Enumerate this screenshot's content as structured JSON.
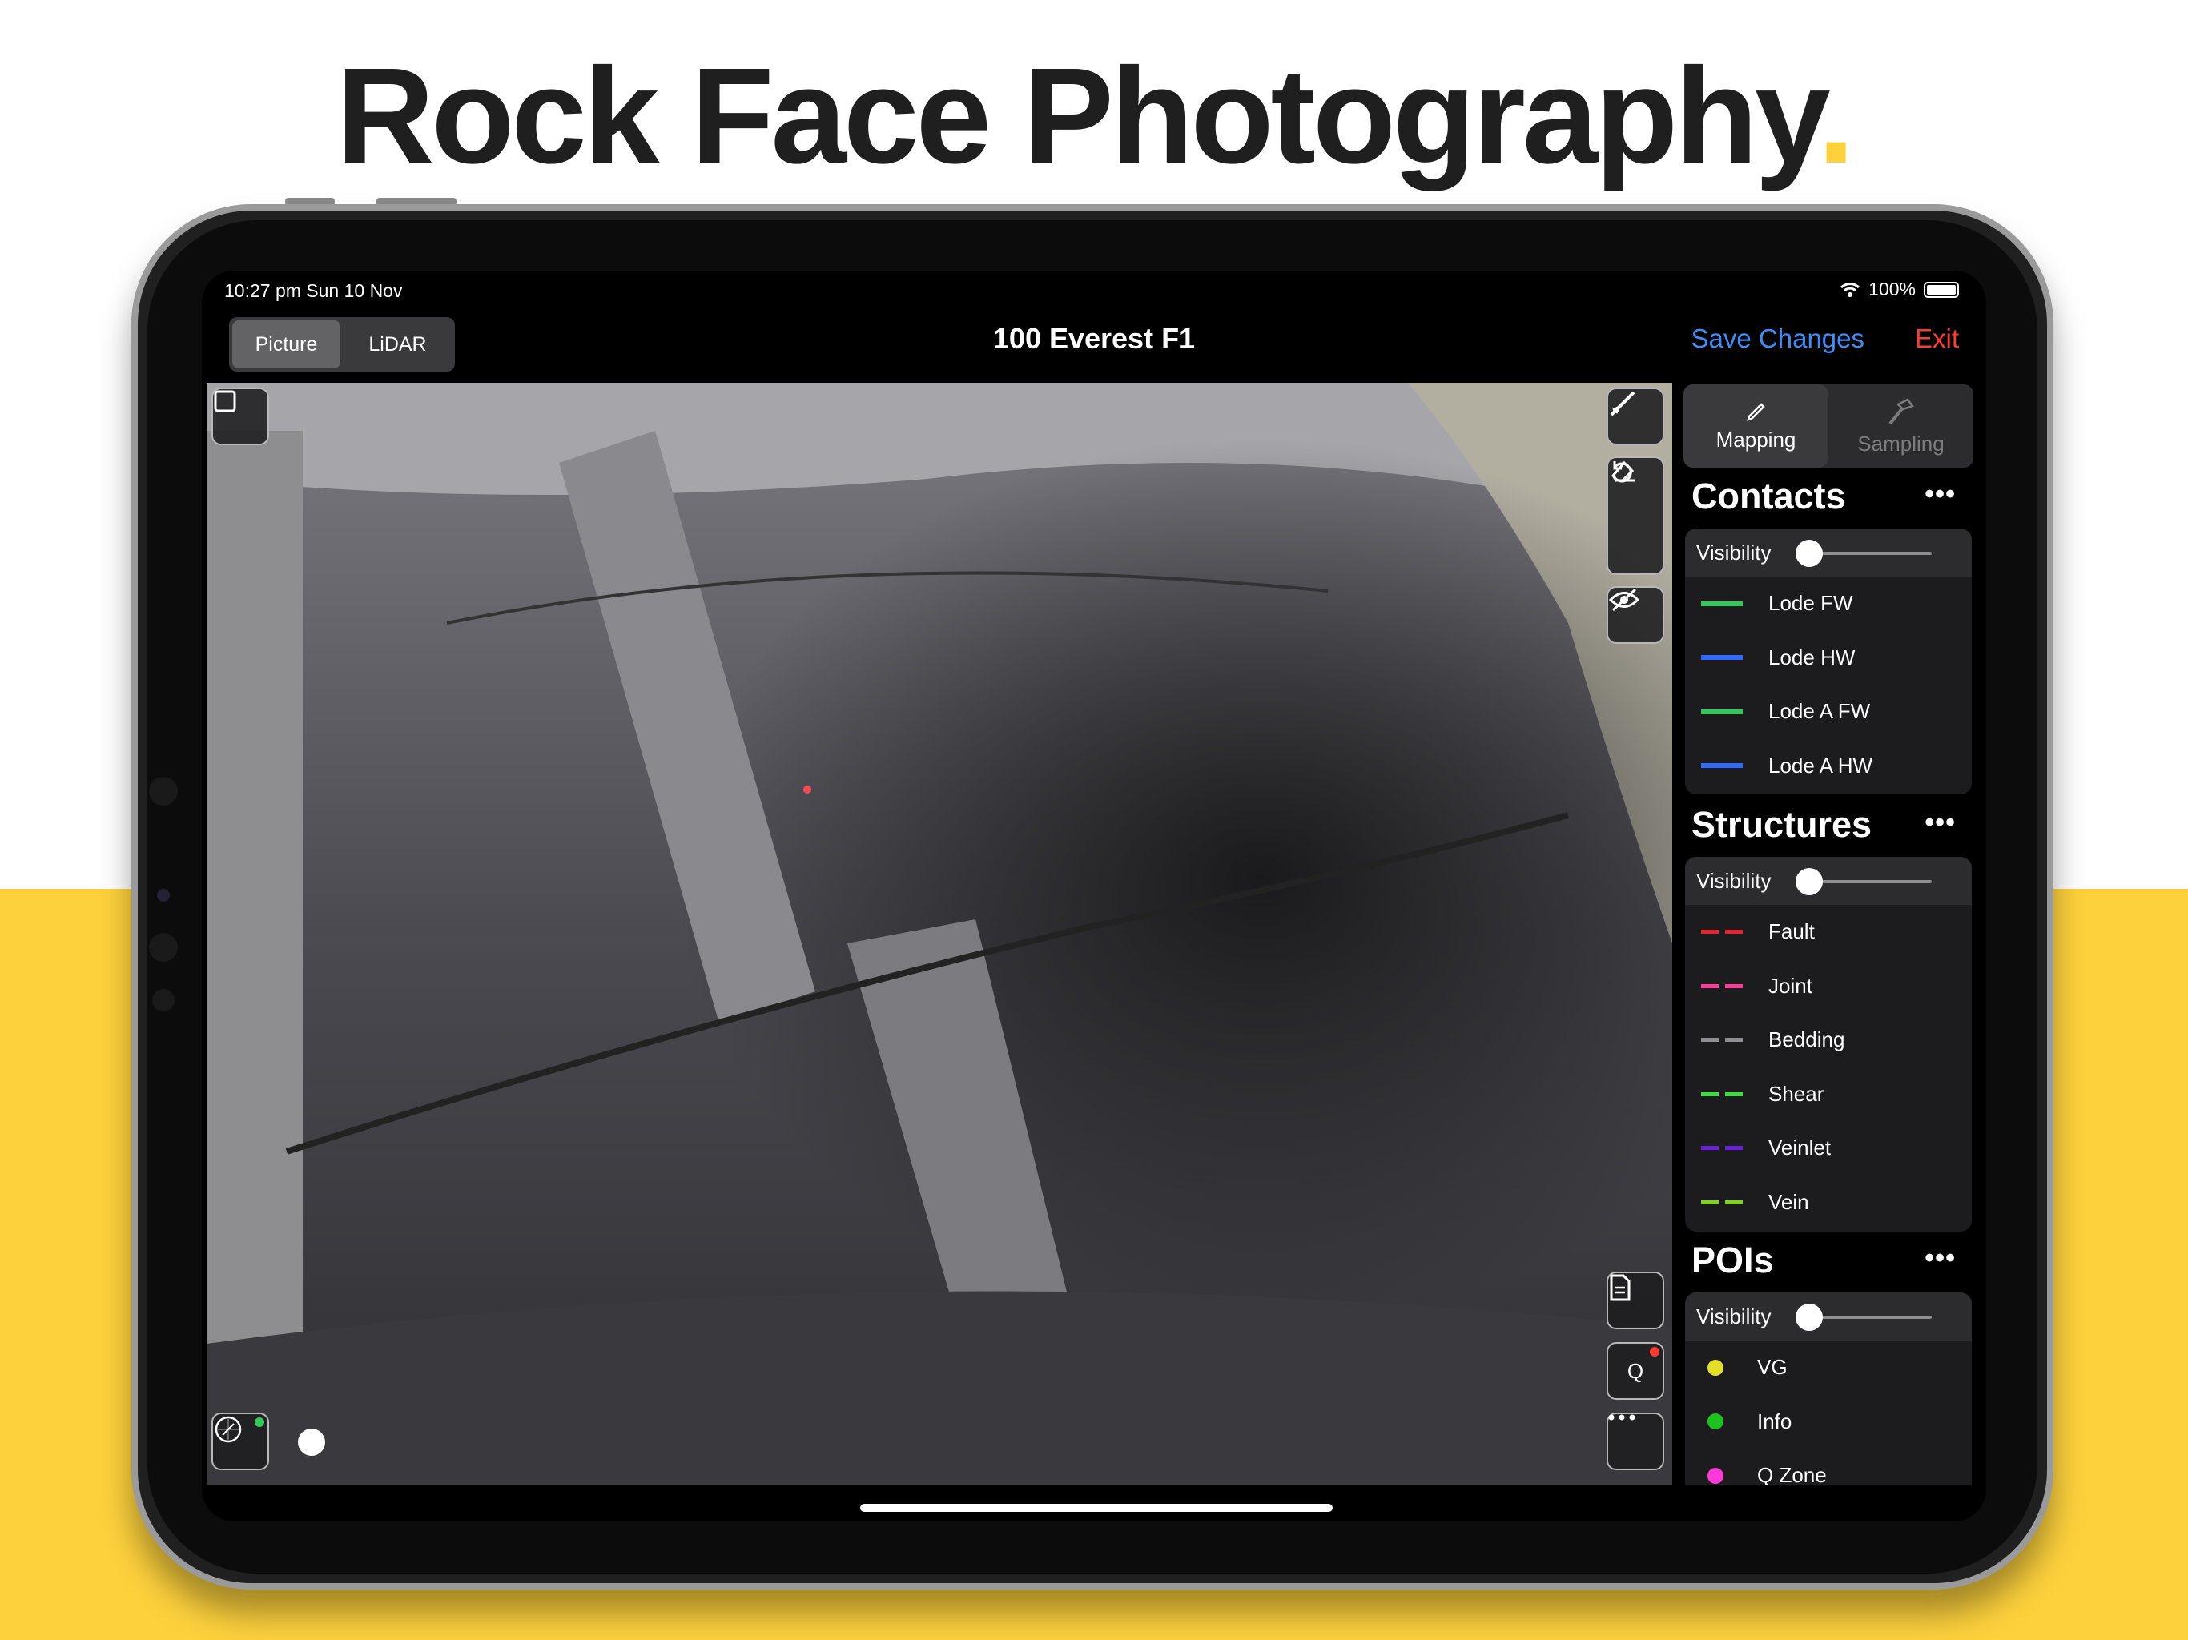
{
  "marketing": {
    "headline": "Rock Face Photography",
    "headline_dot": ".",
    "accent_color": "#fdd13c"
  },
  "status": {
    "time": "10:27 pm   Sun 10 Nov",
    "battery": "100%",
    "wifi_icon": "wifi-icon",
    "battery_level": 1.0
  },
  "header": {
    "segments": [
      {
        "label": "Picture",
        "active": true
      },
      {
        "label": "LiDAR",
        "active": false
      }
    ],
    "title": "100 Everest F1",
    "save_label": "Save Changes",
    "exit_label": "Exit"
  },
  "tools": {
    "select_icon": "square-icon",
    "draw_icon": "line-tool-icon",
    "erase_icon": "eraser-icon",
    "undo_icon": "undo-icon",
    "hide_icon": "eye-slash-icon",
    "notes_icon": "document-icon",
    "q_label": "Q",
    "more_icon": "ellipsis-icon",
    "compass_icon": "compass-icon"
  },
  "panel": {
    "modes": [
      {
        "label": "Mapping",
        "icon": "pencil-icon",
        "active": true
      },
      {
        "label": "Sampling",
        "icon": "hammer-icon",
        "active": false
      }
    ],
    "sections": {
      "contacts": {
        "title": "Contacts",
        "more": "•••",
        "visibility_label": "Visibility",
        "visibility_value": 0.0,
        "items": [
          {
            "label": "Lode FW",
            "color": "#34c759",
            "style": "solid"
          },
          {
            "label": "Lode HW",
            "color": "#2f6bff",
            "style": "solid"
          },
          {
            "label": "Lode A FW",
            "color": "#34c759",
            "style": "solid"
          },
          {
            "label": "Lode A HW",
            "color": "#2f6bff",
            "style": "solid"
          }
        ]
      },
      "structures": {
        "title": "Structures",
        "more": "•••",
        "visibility_label": "Visibility",
        "visibility_value": 0.0,
        "items": [
          {
            "label": "Fault",
            "color": "#e5262f",
            "style": "dashed"
          },
          {
            "label": "Joint",
            "color": "#ff3a9a",
            "style": "dashed"
          },
          {
            "label": "Bedding",
            "color": "#8e8e93",
            "style": "dashed"
          },
          {
            "label": "Shear",
            "color": "#3ddc3d",
            "style": "dashed"
          },
          {
            "label": "Veinlet",
            "color": "#6b22e0",
            "style": "dashed"
          },
          {
            "label": "Vein",
            "color": "#7ed321",
            "style": "dashed"
          }
        ]
      },
      "pois": {
        "title": "POIs",
        "more": "•••",
        "visibility_label": "Visibility",
        "visibility_value": 0.0,
        "items": [
          {
            "label": "VG",
            "color": "#e4e02a"
          },
          {
            "label": "Info",
            "color": "#1ec21e"
          },
          {
            "label": "Q Zone",
            "color": "#ff3ad9"
          }
        ]
      }
    }
  }
}
